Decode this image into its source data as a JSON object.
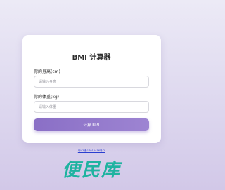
{
  "calculator": {
    "title": "BMI 计算器",
    "height_label": "你的身高(cm)",
    "height_placeholder": "请输入身高",
    "weight_label": "你的体重(kg)",
    "weight_placeholder": "请输入体重",
    "button_label": "计算 BMI"
  },
  "footer": {
    "icp_text": "粤ICP备17012456号-2"
  },
  "logo": {
    "text": "便民库"
  },
  "colors": {
    "accent": "#9278cc",
    "logo": "#1fb3a0",
    "link": "#2a3fd0"
  }
}
